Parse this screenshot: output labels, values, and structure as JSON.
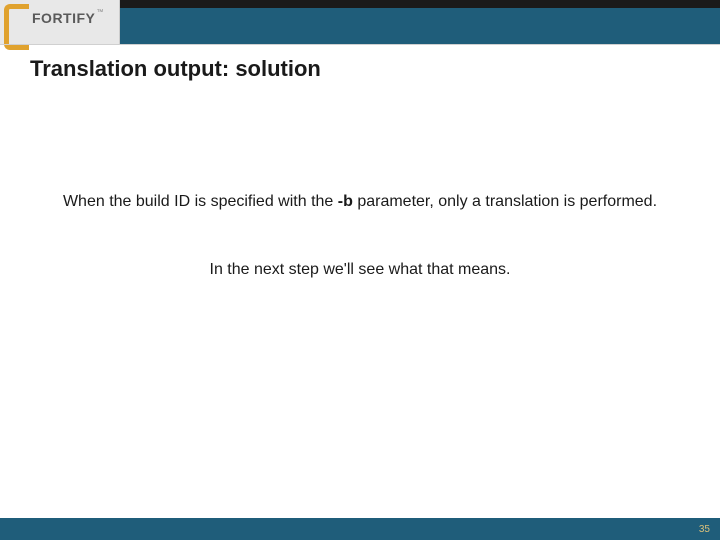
{
  "brand": {
    "name": "FORTIFY",
    "trademark": "™"
  },
  "slide": {
    "title": "Translation output: solution",
    "para1_a": "When the build ID is specified with the ",
    "para1_bold": "-b",
    "para1_b": " parameter, only a translation is performed.",
    "para2": "In the next step we'll see what that means."
  },
  "page_number": "35"
}
